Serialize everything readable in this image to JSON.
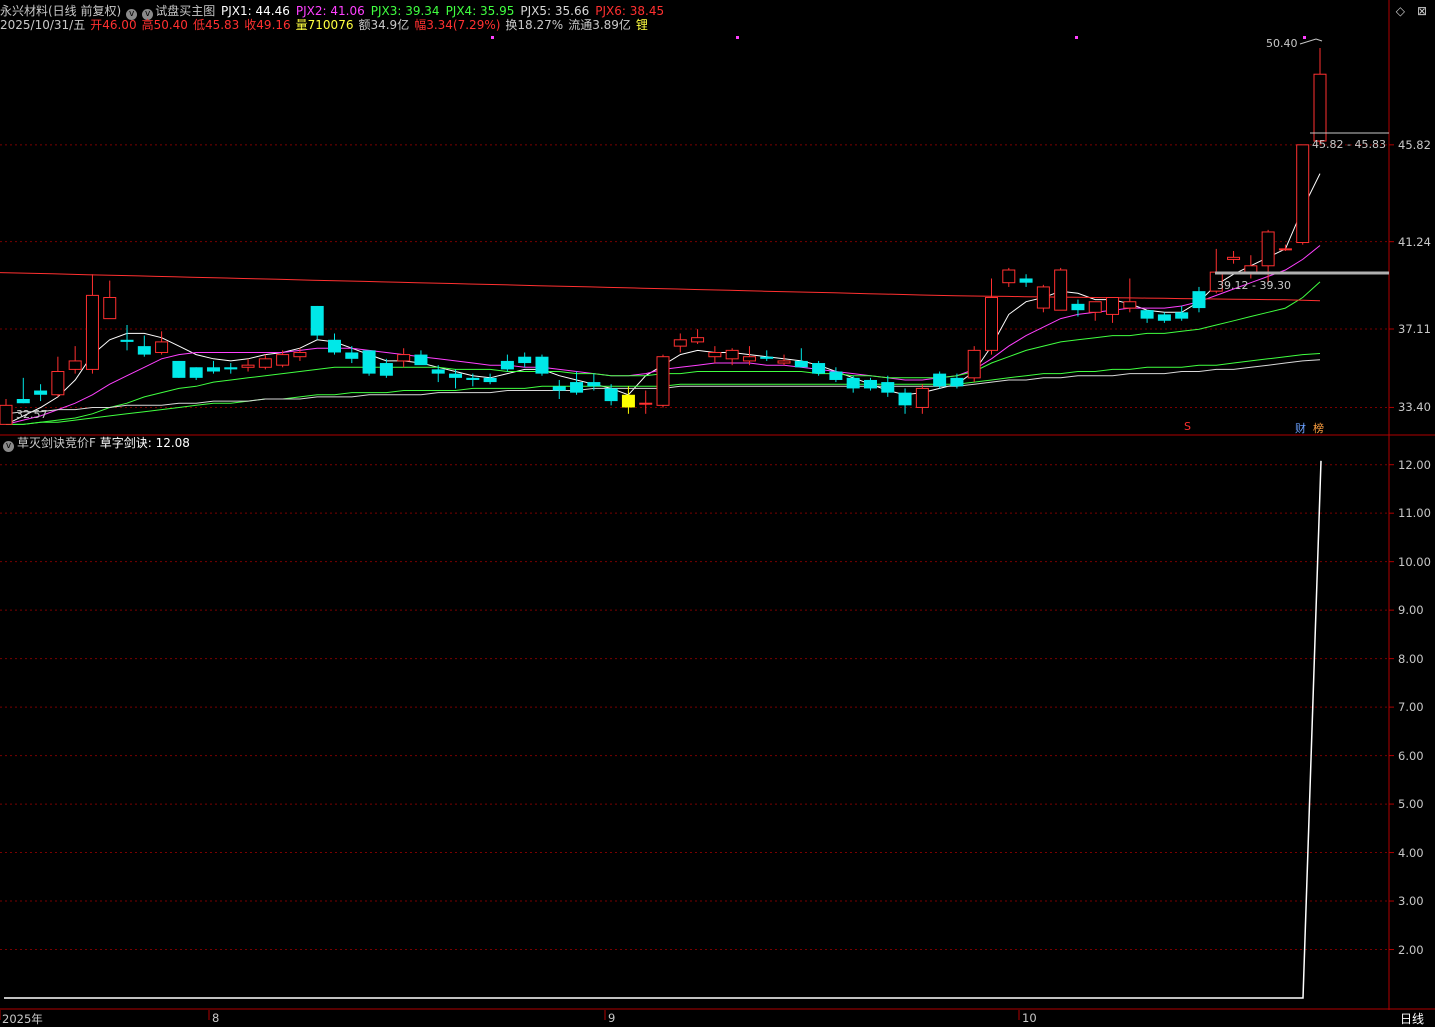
{
  "header": {
    "stock_name": "永兴材料(日线 前复权)",
    "indicator_name": "试盘买主图",
    "ma": [
      {
        "label": "PJX1: 44.46",
        "color": "#ffffff"
      },
      {
        "label": "PJX2: 41.06",
        "color": "#ff40ff"
      },
      {
        "label": "PJX3: 39.34",
        "color": "#40ff40"
      },
      {
        "label": "PJX4: 35.95",
        "color": "#40ff40"
      },
      {
        "label": "PJX5: 35.66",
        "color": "#d8d8d8"
      },
      {
        "label": "PJX6: 38.45",
        "color": "#ff3030"
      }
    ],
    "date": "2025/10/31/五",
    "quote": [
      {
        "label": "开46.00",
        "color": "#ff3030"
      },
      {
        "label": "高50.40",
        "color": "#ff3030"
      },
      {
        "label": "低45.83",
        "color": "#ff3030"
      },
      {
        "label": "收49.16",
        "color": "#ff3030"
      },
      {
        "label": "量710076",
        "color": "#ffff40"
      },
      {
        "label": "额34.9亿",
        "color": "#c8c8c8"
      },
      {
        "label": "幅3.34(7.29%)",
        "color": "#ff3030"
      },
      {
        "label": "换18.27%",
        "color": "#c8c8c8"
      },
      {
        "label": "流通3.89亿",
        "color": "#c8c8c8"
      },
      {
        "label": "锂",
        "color": "#ffff40"
      }
    ]
  },
  "window_buttons": {
    "restore": "◇",
    "close": "⊠"
  },
  "price_axis": [
    "45.82",
    "41.24",
    "37.11",
    "33.40"
  ],
  "price_annotations": {
    "high": "50.40",
    "range_upper": "45.82 - 45.83",
    "range_lower": "39.12 - 39.30",
    "low": "32.57"
  },
  "markers": {
    "s_marker": "S",
    "finance_tag": "财",
    "rank_tag": "榜"
  },
  "sub_panel": {
    "title": "草灭剑诀竞价F",
    "value_label": "草字剑诀: 12.08",
    "axis": [
      "12.00",
      "11.00",
      "10.00",
      "9.00",
      "8.00",
      "7.00",
      "6.00",
      "5.00",
      "4.00",
      "3.00",
      "2.00"
    ]
  },
  "time_axis": [
    "2025年",
    "8",
    "9",
    "10"
  ],
  "period_label": "日线",
  "colors": {
    "up": "#ff3030",
    "down": "#00e8e8",
    "grid": "#7a0000",
    "axis": "#b00000",
    "signal": "#ffff00"
  },
  "chart_data": [
    {
      "type": "candlestick",
      "title": "永兴材料 日线",
      "ylim": [
        32.57,
        50.4
      ],
      "ohlc": [
        {
          "o": 32.6,
          "h": 33.8,
          "l": 32.6,
          "c": 33.5
        },
        {
          "o": 33.8,
          "h": 34.8,
          "l": 33.6,
          "c": 33.6
        },
        {
          "o": 34.2,
          "h": 34.5,
          "l": 33.7,
          "c": 34.0
        },
        {
          "o": 34.0,
          "h": 35.8,
          "l": 33.9,
          "c": 35.1
        },
        {
          "o": 35.2,
          "h": 36.3,
          "l": 35.0,
          "c": 35.6
        },
        {
          "o": 35.2,
          "h": 39.7,
          "l": 35.0,
          "c": 38.7
        },
        {
          "o": 37.6,
          "h": 39.4,
          "l": 37.6,
          "c": 38.6
        },
        {
          "o": 36.6,
          "h": 37.3,
          "l": 36.1,
          "c": 36.5
        },
        {
          "o": 36.3,
          "h": 36.8,
          "l": 35.8,
          "c": 35.9
        },
        {
          "o": 36.0,
          "h": 37.0,
          "l": 35.9,
          "c": 36.5
        },
        {
          "o": 35.6,
          "h": 35.6,
          "l": 34.8,
          "c": 34.8
        },
        {
          "o": 35.3,
          "h": 35.3,
          "l": 34.7,
          "c": 34.8
        },
        {
          "o": 35.3,
          "h": 35.6,
          "l": 35.0,
          "c": 35.1
        },
        {
          "o": 35.3,
          "h": 35.5,
          "l": 35.0,
          "c": 35.2
        },
        {
          "o": 35.3,
          "h": 35.7,
          "l": 35.1,
          "c": 35.4
        },
        {
          "o": 35.3,
          "h": 35.9,
          "l": 35.2,
          "c": 35.7
        },
        {
          "o": 35.4,
          "h": 36.1,
          "l": 35.3,
          "c": 35.9
        },
        {
          "o": 35.8,
          "h": 36.2,
          "l": 35.6,
          "c": 36.0
        },
        {
          "o": 38.2,
          "h": 38.2,
          "l": 36.6,
          "c": 36.8
        },
        {
          "o": 36.6,
          "h": 36.9,
          "l": 35.9,
          "c": 36.0
        },
        {
          "o": 36.0,
          "h": 36.3,
          "l": 35.5,
          "c": 35.7
        },
        {
          "o": 36.1,
          "h": 36.1,
          "l": 34.9,
          "c": 35.0
        },
        {
          "o": 35.5,
          "h": 35.7,
          "l": 34.8,
          "c": 34.9
        },
        {
          "o": 35.6,
          "h": 36.2,
          "l": 35.3,
          "c": 35.9
        },
        {
          "o": 35.9,
          "h": 36.1,
          "l": 35.5,
          "c": 35.4
        },
        {
          "o": 35.2,
          "h": 35.4,
          "l": 34.6,
          "c": 35.0
        },
        {
          "o": 35.0,
          "h": 35.2,
          "l": 34.3,
          "c": 34.8
        },
        {
          "o": 34.8,
          "h": 35.0,
          "l": 34.4,
          "c": 34.7
        },
        {
          "o": 34.8,
          "h": 35.0,
          "l": 34.5,
          "c": 34.6
        },
        {
          "o": 35.6,
          "h": 35.9,
          "l": 35.1,
          "c": 35.2
        },
        {
          "o": 35.8,
          "h": 36.0,
          "l": 35.3,
          "c": 35.5
        },
        {
          "o": 35.8,
          "h": 35.9,
          "l": 34.9,
          "c": 35.0
        },
        {
          "o": 34.4,
          "h": 34.7,
          "l": 33.8,
          "c": 34.2
        },
        {
          "o": 34.6,
          "h": 35.1,
          "l": 34.0,
          "c": 34.1
        },
        {
          "o": 34.6,
          "h": 35.0,
          "l": 34.2,
          "c": 34.4
        },
        {
          "o": 34.3,
          "h": 34.5,
          "l": 33.5,
          "c": 33.7
        },
        {
          "o": 34.0,
          "h": 34.4,
          "l": 33.1,
          "c": 33.4
        },
        {
          "o": 33.6,
          "h": 34.2,
          "l": 33.1,
          "c": 33.6
        },
        {
          "o": 33.5,
          "h": 35.9,
          "l": 33.4,
          "c": 35.8
        },
        {
          "o": 36.3,
          "h": 36.9,
          "l": 36.0,
          "c": 36.6
        },
        {
          "o": 36.5,
          "h": 37.1,
          "l": 36.4,
          "c": 36.7
        },
        {
          "o": 35.8,
          "h": 36.3,
          "l": 35.5,
          "c": 36.0
        },
        {
          "o": 35.7,
          "h": 36.2,
          "l": 35.4,
          "c": 36.1
        },
        {
          "o": 35.6,
          "h": 36.3,
          "l": 35.4,
          "c": 35.8
        },
        {
          "o": 35.8,
          "h": 36.1,
          "l": 35.6,
          "c": 35.7
        },
        {
          "o": 35.5,
          "h": 35.9,
          "l": 35.4,
          "c": 35.6
        },
        {
          "o": 35.6,
          "h": 36.2,
          "l": 35.3,
          "c": 35.3
        },
        {
          "o": 35.5,
          "h": 35.6,
          "l": 34.9,
          "c": 35.0
        },
        {
          "o": 35.1,
          "h": 35.3,
          "l": 34.6,
          "c": 34.7
        },
        {
          "o": 34.8,
          "h": 34.9,
          "l": 34.1,
          "c": 34.3
        },
        {
          "o": 34.7,
          "h": 34.8,
          "l": 34.2,
          "c": 34.3
        },
        {
          "o": 34.6,
          "h": 34.9,
          "l": 33.9,
          "c": 34.1
        },
        {
          "o": 34.1,
          "h": 34.3,
          "l": 33.1,
          "c": 33.5
        },
        {
          "o": 33.4,
          "h": 34.5,
          "l": 33.1,
          "c": 34.3
        },
        {
          "o": 35.0,
          "h": 35.1,
          "l": 34.3,
          "c": 34.4
        },
        {
          "o": 34.8,
          "h": 35.0,
          "l": 34.3,
          "c": 34.4
        },
        {
          "o": 34.8,
          "h": 36.3,
          "l": 34.6,
          "c": 36.1
        },
        {
          "o": 36.1,
          "h": 39.5,
          "l": 35.9,
          "c": 38.6
        },
        {
          "o": 39.3,
          "h": 40.0,
          "l": 39.1,
          "c": 39.9
        },
        {
          "o": 39.5,
          "h": 39.7,
          "l": 39.1,
          "c": 39.3
        },
        {
          "o": 38.1,
          "h": 39.2,
          "l": 37.9,
          "c": 39.1
        },
        {
          "o": 38.0,
          "h": 40.0,
          "l": 38.0,
          "c": 39.9
        },
        {
          "o": 38.3,
          "h": 38.5,
          "l": 37.7,
          "c": 38.0
        },
        {
          "o": 37.9,
          "h": 38.4,
          "l": 37.5,
          "c": 38.4
        },
        {
          "o": 37.8,
          "h": 38.6,
          "l": 37.4,
          "c": 38.6
        },
        {
          "o": 38.1,
          "h": 39.5,
          "l": 37.9,
          "c": 38.4
        },
        {
          "o": 38.0,
          "h": 38.0,
          "l": 37.4,
          "c": 37.6
        },
        {
          "o": 37.8,
          "h": 37.9,
          "l": 37.4,
          "c": 37.5
        },
        {
          "o": 37.9,
          "h": 38.2,
          "l": 37.5,
          "c": 37.6
        },
        {
          "o": 38.9,
          "h": 39.1,
          "l": 37.9,
          "c": 38.1
        },
        {
          "o": 38.9,
          "h": 40.9,
          "l": 38.8,
          "c": 39.8
        },
        {
          "o": 40.4,
          "h": 40.8,
          "l": 40.2,
          "c": 40.5
        },
        {
          "o": 39.8,
          "h": 40.6,
          "l": 39.5,
          "c": 40.1
        },
        {
          "o": 40.1,
          "h": 41.8,
          "l": 39.3,
          "c": 41.7
        },
        {
          "o": 40.9,
          "h": 41.1,
          "l": 40.8,
          "c": 40.9
        },
        {
          "o": 41.2,
          "h": 45.82,
          "l": 41.1,
          "c": 45.82
        },
        {
          "o": 46.0,
          "h": 50.4,
          "l": 45.83,
          "c": 49.16
        }
      ],
      "signal_index": 36,
      "ma_series": [
        {
          "name": "PJX1",
          "color": "#ffffff",
          "values": [
            32.6,
            33.0,
            33.4,
            33.9,
            34.7,
            35.9,
            36.6,
            36.9,
            36.9,
            36.7,
            36.3,
            35.9,
            35.7,
            35.6,
            35.7,
            35.9,
            36.0,
            36.2,
            36.6,
            36.5,
            36.2,
            35.9,
            35.6,
            35.6,
            35.5,
            35.3,
            35.1,
            34.9,
            34.8,
            35.0,
            35.2,
            35.2,
            34.9,
            34.7,
            34.5,
            34.3,
            34.0,
            34.9,
            35.4,
            35.9,
            36.1,
            36.0,
            36.0,
            35.9,
            35.8,
            35.7,
            35.6,
            35.4,
            35.1,
            34.8,
            34.5,
            34.2,
            34.0,
            34.1,
            34.3,
            34.5,
            35.1,
            36.3,
            37.8,
            38.4,
            38.6,
            38.9,
            38.8,
            38.5,
            38.5,
            38.3,
            38.0,
            37.9,
            37.9,
            38.4,
            39.2,
            39.7,
            40.1,
            40.5,
            40.9,
            42.8,
            44.46
          ]
        },
        {
          "name": "PJX2",
          "color": "#ff40ff",
          "values": [
            32.6,
            32.8,
            33.0,
            33.3,
            33.6,
            34.0,
            34.5,
            34.9,
            35.3,
            35.7,
            35.9,
            36.0,
            36.0,
            36.0,
            36.0,
            36.0,
            36.0,
            36.1,
            36.2,
            36.2,
            36.2,
            36.1,
            36.0,
            35.9,
            35.8,
            35.7,
            35.6,
            35.5,
            35.4,
            35.4,
            35.3,
            35.3,
            35.2,
            35.1,
            35.0,
            34.9,
            34.9,
            35.0,
            35.2,
            35.3,
            35.4,
            35.5,
            35.5,
            35.5,
            35.4,
            35.4,
            35.3,
            35.2,
            35.1,
            35.0,
            34.9,
            34.8,
            34.7,
            34.7,
            34.8,
            34.9,
            35.2,
            35.7,
            36.3,
            36.8,
            37.2,
            37.6,
            37.8,
            37.9,
            38.0,
            38.1,
            38.1,
            38.1,
            38.2,
            38.4,
            38.7,
            39.0,
            39.3,
            39.6,
            39.9,
            40.4,
            41.06
          ]
        },
        {
          "name": "PJX3",
          "color": "#40ff40",
          "values": [
            32.6,
            32.6,
            32.7,
            32.8,
            32.9,
            33.1,
            33.4,
            33.6,
            33.9,
            34.1,
            34.3,
            34.4,
            34.6,
            34.7,
            34.8,
            34.9,
            35.0,
            35.1,
            35.2,
            35.3,
            35.3,
            35.3,
            35.3,
            35.3,
            35.3,
            35.3,
            35.2,
            35.2,
            35.2,
            35.1,
            35.1,
            35.1,
            35.1,
            35.0,
            35.0,
            34.9,
            34.9,
            34.9,
            35.0,
            35.0,
            35.1,
            35.1,
            35.1,
            35.1,
            35.1,
            35.1,
            35.1,
            35.0,
            35.0,
            34.9,
            34.9,
            34.8,
            34.8,
            34.8,
            34.8,
            34.9,
            35.1,
            35.5,
            35.8,
            36.1,
            36.3,
            36.5,
            36.6,
            36.7,
            36.8,
            36.8,
            36.9,
            36.9,
            37.0,
            37.1,
            37.3,
            37.5,
            37.7,
            37.9,
            38.1,
            38.6,
            39.34
          ]
        },
        {
          "name": "PJX4",
          "color": "#40ff40",
          "values": [
            32.6,
            32.6,
            32.7,
            32.7,
            32.8,
            32.9,
            33.0,
            33.1,
            33.2,
            33.3,
            33.4,
            33.5,
            33.6,
            33.6,
            33.7,
            33.8,
            33.8,
            33.9,
            34.0,
            34.0,
            34.1,
            34.1,
            34.1,
            34.2,
            34.2,
            34.2,
            34.2,
            34.3,
            34.3,
            34.3,
            34.3,
            34.4,
            34.4,
            34.4,
            34.4,
            34.4,
            34.4,
            34.4,
            34.4,
            34.5,
            34.5,
            34.5,
            34.5,
            34.5,
            34.5,
            34.5,
            34.5,
            34.5,
            34.5,
            34.5,
            34.5,
            34.5,
            34.5,
            34.5,
            34.5,
            34.5,
            34.6,
            34.7,
            34.8,
            34.9,
            35.0,
            35.0,
            35.1,
            35.1,
            35.2,
            35.2,
            35.3,
            35.3,
            35.3,
            35.4,
            35.4,
            35.5,
            35.6,
            35.7,
            35.8,
            35.9,
            35.95
          ]
        },
        {
          "name": "PJX5",
          "color": "#d8d8d8",
          "values": [
            33.1,
            33.2,
            33.2,
            33.3,
            33.3,
            33.4,
            33.4,
            33.5,
            33.5,
            33.5,
            33.6,
            33.6,
            33.7,
            33.7,
            33.7,
            33.8,
            33.8,
            33.8,
            33.9,
            33.9,
            33.9,
            34.0,
            34.0,
            34.0,
            34.0,
            34.1,
            34.1,
            34.1,
            34.1,
            34.2,
            34.2,
            34.2,
            34.2,
            34.2,
            34.3,
            34.3,
            34.3,
            34.3,
            34.3,
            34.4,
            34.4,
            34.4,
            34.4,
            34.4,
            34.4,
            34.4,
            34.4,
            34.4,
            34.4,
            34.4,
            34.4,
            34.4,
            34.4,
            34.4,
            34.4,
            34.4,
            34.5,
            34.6,
            34.7,
            34.7,
            34.8,
            34.8,
            34.9,
            34.9,
            34.9,
            35.0,
            35.0,
            35.0,
            35.1,
            35.1,
            35.2,
            35.2,
            35.3,
            35.4,
            35.5,
            35.6,
            35.66
          ]
        },
        {
          "name": "PJX6",
          "color": "#ff3030",
          "values": [
            39.78,
            39.76,
            39.74,
            39.72,
            39.7,
            39.68,
            39.66,
            39.64,
            39.62,
            39.6,
            39.58,
            39.56,
            39.54,
            39.52,
            39.5,
            39.48,
            39.46,
            39.44,
            39.42,
            39.4,
            39.38,
            39.36,
            39.34,
            39.32,
            39.3,
            39.28,
            39.26,
            39.24,
            39.22,
            39.2,
            39.18,
            39.16,
            39.14,
            39.12,
            39.1,
            39.08,
            39.06,
            39.04,
            39.02,
            39.0,
            38.98,
            38.96,
            38.94,
            38.92,
            38.9,
            38.88,
            38.86,
            38.84,
            38.82,
            38.8,
            38.78,
            38.76,
            38.74,
            38.72,
            38.7,
            38.68,
            38.67,
            38.66,
            38.65,
            38.64,
            38.63,
            38.62,
            38.61,
            38.6,
            38.59,
            38.58,
            38.57,
            38.56,
            38.55,
            38.54,
            38.53,
            38.52,
            38.51,
            38.5,
            38.49,
            38.47,
            38.45
          ]
        }
      ]
    },
    {
      "type": "line",
      "title": "草灭剑诀竞价F",
      "ylim": [
        1.0,
        12.2
      ],
      "series": [
        {
          "name": "草字剑诀",
          "values_flat": 1.0,
          "last_values": [
            1.0,
            12.08
          ]
        }
      ]
    }
  ]
}
